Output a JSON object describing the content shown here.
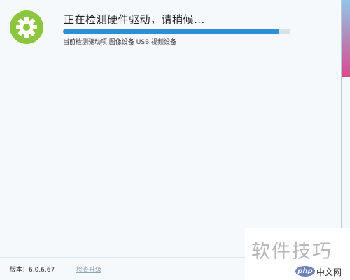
{
  "installer": {
    "title": "正在检测硬件驱动，请稍候...",
    "progress_fraction": 0.95,
    "detail": "当前检测驱动项 图像设备 USB 视频设备",
    "icon": "gear-icon",
    "accent_color": "#8cc63f",
    "progress_color": "#2d8fd5"
  },
  "footer": {
    "version": "版本：6.0.6.67",
    "check_update": "检查升级"
  },
  "watermark": {
    "text": "软件技巧",
    "site": "中文网",
    "logo": "php"
  }
}
